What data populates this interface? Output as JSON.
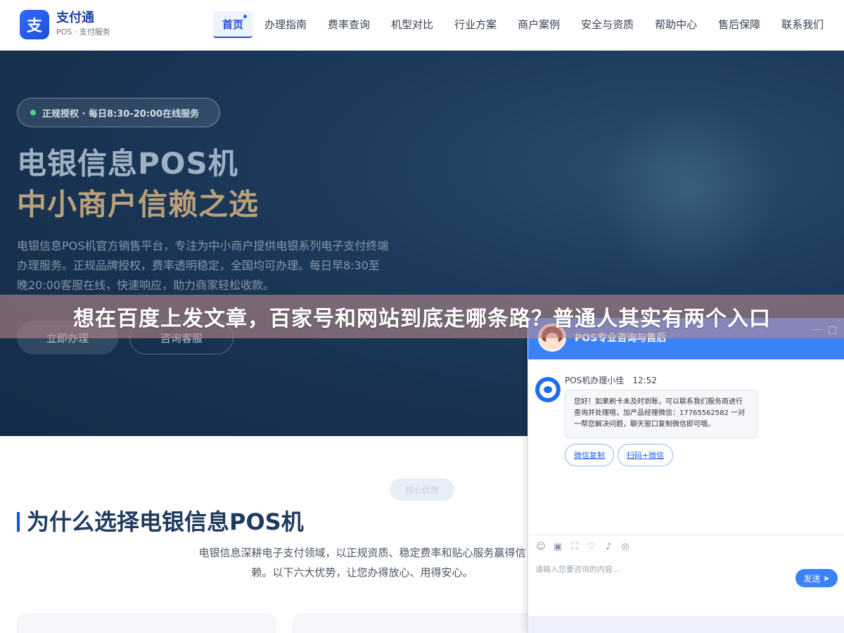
{
  "header": {
    "logo_mark": "支",
    "logo_title": "支付通",
    "logo_sub": "POS · 支付服务",
    "nav": [
      "首页",
      "办理指南",
      "费率查询",
      "机型对比",
      "行业方案",
      "商户案例",
      "安全与资质",
      "帮助中心",
      "售后保障",
      "联系我们"
    ]
  },
  "hero": {
    "badge": "正规授权 · 每日8:30-20:00在线服务",
    "title": "电银信息POS机",
    "title2": "中小商户信赖之选",
    "description": "电银信息POS机官方销售平台，专注为中小商户提供电银系列电子支付终端办理服务。正规品牌授权，费率透明稳定，全国均可办理。每日早8:30至晚20:00客服在线，快速响应，助力商家轻松收款。",
    "btn_primary": "立即办理",
    "btn_secondary": "咨询客服"
  },
  "banner": {
    "text": "想在百度上发文章，百家号和网站到底走哪条路？普通人其实有两个入口"
  },
  "section": {
    "chip": "核心优势",
    "title": "为什么选择电银信息POS机",
    "description": "电银信息深耕电子支付领域，以正规资质、稳定费率和贴心服务赢得信赖。以下六大优势，让您办得放心、用得安心。"
  },
  "chat": {
    "title": "POS专业咨询与售后",
    "agent_name": "POS机办理小佳",
    "time": "12:52",
    "message": "您好！如果刷卡未及时到账，可以联系我们服务商进行查询并处理哦，加产品经理微信：17765562582 一对一帮您解决问题，聊天窗口复制微信即可哦。",
    "quick_replies": [
      "微信复制",
      "扫码+微信"
    ],
    "toolbar_icons": [
      "emoji-icon",
      "image-icon",
      "screenshot-icon",
      "evaluate-icon",
      "voice-icon",
      "wechat-icon"
    ],
    "input_placeholder": "请输入您要咨询的内容...",
    "send_label": "发送"
  },
  "colors": {
    "brand": "#2f6bff",
    "hero_bg": "#1d3b5d",
    "accent_gold": "#b9a07a",
    "chat_header": "#3b82f6"
  }
}
